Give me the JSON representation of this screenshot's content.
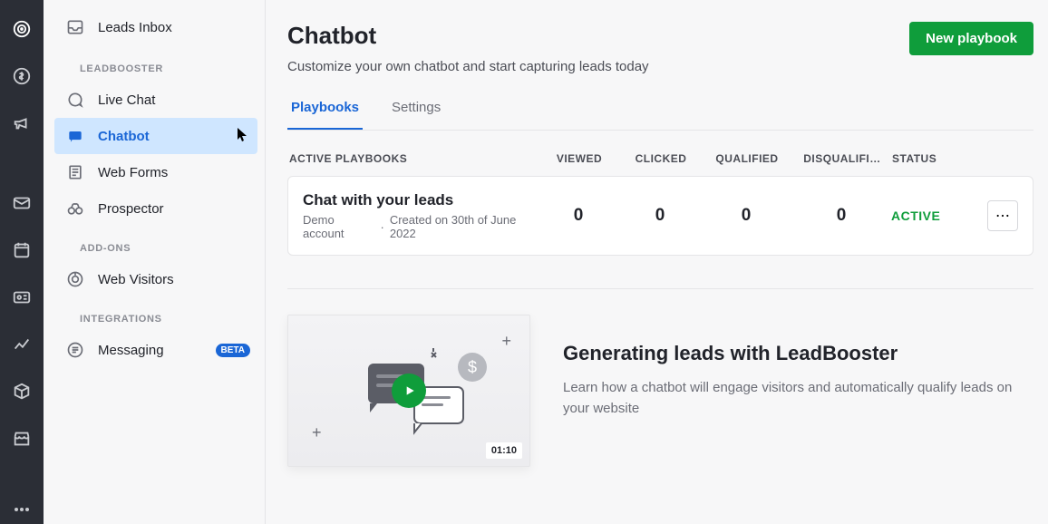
{
  "rail": {
    "items": [
      "target",
      "deals",
      "campaign",
      "mail",
      "calendar",
      "contacts",
      "insights",
      "products",
      "marketplace"
    ]
  },
  "sidebar": {
    "top_item": {
      "label": "Leads Inbox"
    },
    "sections": [
      {
        "heading": "LEADBOOSTER",
        "items": [
          {
            "label": "Live Chat"
          },
          {
            "label": "Chatbot",
            "active": true
          },
          {
            "label": "Web Forms"
          },
          {
            "label": "Prospector"
          }
        ]
      },
      {
        "heading": "ADD-ONS",
        "items": [
          {
            "label": "Web Visitors"
          }
        ]
      },
      {
        "heading": "INTEGRATIONS",
        "items": [
          {
            "label": "Messaging",
            "badge": "BETA"
          }
        ]
      }
    ]
  },
  "page": {
    "title": "Chatbot",
    "subtitle": "Customize your own chatbot and start capturing leads today",
    "new_button": "New playbook"
  },
  "tabs": {
    "items": [
      {
        "label": "Playbooks",
        "active": true
      },
      {
        "label": "Settings"
      }
    ]
  },
  "table": {
    "section_label": "ACTIVE PLAYBOOKS",
    "headers": {
      "viewed": "VIEWED",
      "clicked": "CLICKED",
      "qualified": "QUALIFIED",
      "disqualified": "DISQUALIFI…",
      "status": "STATUS"
    },
    "rows": [
      {
        "title": "Chat with your leads",
        "meta_account": "Demo account",
        "meta_sep": "·",
        "meta_created": "Created on 30th of June 2022",
        "viewed": "0",
        "clicked": "0",
        "qualified": "0",
        "disqualified": "0",
        "status": "ACTIVE"
      }
    ]
  },
  "promo": {
    "duration": "01:10",
    "title": "Generating leads with LeadBooster",
    "text": "Learn how a chatbot will engage visitors and automatically qualify leads on your website"
  },
  "colors": {
    "accent_blue": "#1a66d6",
    "accent_green": "#0f9d3b"
  }
}
